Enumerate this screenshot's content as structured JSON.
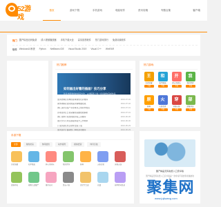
{
  "brand": {
    "logo_text": "52游戏"
  },
  "nav": {
    "items": [
      "首页",
      "游戏下载",
      "手机游戏",
      "电脑软件",
      "资讯攻略",
      "专题合集"
    ],
    "top_right": "客户端"
  },
  "tags": {
    "row1_label": "热门",
    "row1": [
      "国产精品无码免费",
      "成人视频播放器",
      "手机下载大全",
      "高清影视软件",
      "热门游戏排行",
      "免费阅读软件"
    ],
    "row2_label": "软件",
    "row2": [
      "Windows10系统",
      "Python",
      "NetBeans IDE",
      "Visual Studio 2019",
      "Visual C++",
      "WinRAR"
    ]
  },
  "main": {
    "section_title": "热门推荐",
    "feature": {
      "title": "如何画出好看的插画？技巧分享",
      "subtitle": "新手也能学会的绘画方法，从线稿到上色一步步教你完成作品"
    },
    "news": [
      {
        "title": "[游戏攻略] 原神新版本角色培养推荐",
        "date": "2024-07-02"
      },
      {
        "title": "[软件教程] 如何快速清理电脑垃圾",
        "date": "2024-07-02"
      },
      {
        "title": "[热门资讯] 国产手游本月上线新作盘点",
        "date": "2024-07-01"
      },
      {
        "title": "[手机游戏] 王者荣耀新英雄技能解析",
        "date": "2024-07-01"
      },
      {
        "title": "[热门软件] 免费视频剪辑工具推荐",
        "date": "2024-06-30"
      },
      {
        "title": "[技巧分享] 浏览器插件提升工作效率",
        "date": "2024-06-30"
      },
      {
        "title": "[下载专题] 办公软件合集下载",
        "date": "2024-06-29"
      },
      {
        "title": "[游戏资讯] 暑期热门单机游戏推荐",
        "date": "2024-06-29"
      }
    ]
  },
  "hot": {
    "title": "热门游戏",
    "apps": [
      {
        "name": "王者荣耀",
        "btn": "下载",
        "color": "#f4a000"
      },
      {
        "name": "和平精英",
        "btn": "下载",
        "color": "#26a3d6"
      },
      {
        "name": "开心消消乐",
        "btn": "下载",
        "color": "#ff6f68"
      },
      {
        "name": "我的世界",
        "btn": "下载",
        "color": "#5bb447"
      },
      {
        "name": "原神",
        "btn": "下载",
        "color": "#ff9f00"
      },
      {
        "name": "火影忍者",
        "btn": "下载",
        "color": "#4e77d8"
      },
      {
        "name": "穿越火线",
        "btn": "下载",
        "color": "#d94743"
      },
      {
        "name": "部落冲突",
        "btn": "下载",
        "color": "#7bb84d"
      }
    ]
  },
  "downloads": {
    "title": "手游下载",
    "filters": [
      "全部",
      "角色扮演",
      "休闲益智",
      "动作冒险",
      "模拟经营",
      "体育竞技"
    ],
    "items": [
      "王者荣耀",
      "和平精英",
      "开心消消乐",
      "我的世界",
      "原神",
      "火影忍者",
      "穿越火线",
      "部落冲突",
      "植物大战僵尸",
      "蛋仔派对",
      "第五人格",
      "金铲铲之战",
      "光遇",
      "崩坏星穹铁道"
    ]
  },
  "promo": {
    "caption": "国产精品无码免费入口安卓版",
    "desc": "国产精品无码免费入口安卓版是一款非常不错的影视播放软件"
  },
  "watermark": {
    "text": "聚集网",
    "sub": "www.jujiwang.com"
  }
}
